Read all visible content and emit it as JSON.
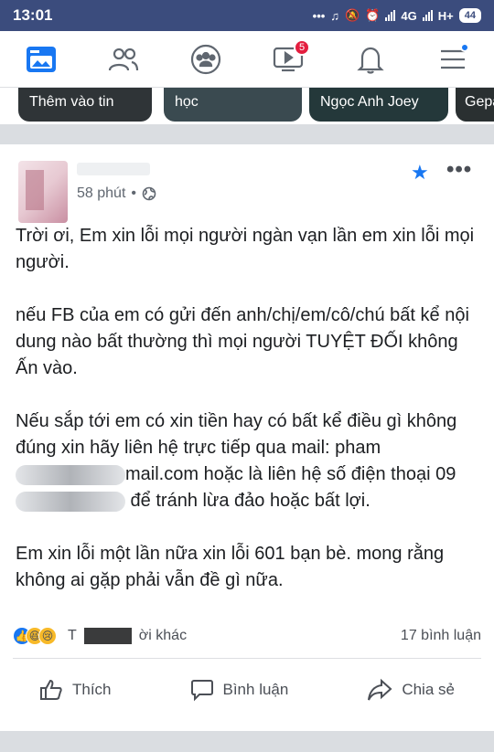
{
  "status_bar": {
    "time": "13:01",
    "network_label": "4G",
    "network2_label": "H+",
    "battery": "44"
  },
  "nav": {
    "icons": [
      "news-feed-icon",
      "friends-icon",
      "groups-icon",
      "watch-icon",
      "notifications-icon",
      "menu-icon"
    ],
    "watch_badge": "5",
    "accent": "#1877f2"
  },
  "stories": [
    {
      "label": "Thêm vào tin"
    },
    {
      "label": "học"
    },
    {
      "label": "Ngọc Anh Joey"
    },
    {
      "label": "Gepa"
    }
  ],
  "post": {
    "time": "58 phút",
    "separator": "•",
    "paragraphs": [
      "Trời ơi, Em xin lỗi mọi người ngàn vạn lần em xin lỗi mọi người.",
      "nếu FB của em có gửi đến anh/chị/em/cô/chú bất kể nội dung nào bất thường thì mọi  người TUYỆT ĐỐI không Ấn vào.",
      "Em xin lỗi một lần nữa xin lỗi 601 bạn bè. mong rằng không ai gặp phải vẫn đề gì nữa."
    ],
    "para3_line1": "Nếu sắp tới em có xin tiền hay có bất kể điều gì không đúng xin hãy liên hệ trực tiếp qua mail:",
    "para3_mail_prefix": "pham",
    "para3_mail_suffix": "mail.com hoặc là liên hệ số",
    "para3_phone_prefix": "điện thoại 09",
    "para3_phone_suffix": " để tránh lừa đảo hoặc bất lợi.",
    "reactions_others": "ời khác",
    "reactions_prefix": "T",
    "comments_count": "17 bình luận"
  },
  "actions": {
    "like": "Thích",
    "comment": "Bình luận",
    "share": "Chia sẻ"
  }
}
